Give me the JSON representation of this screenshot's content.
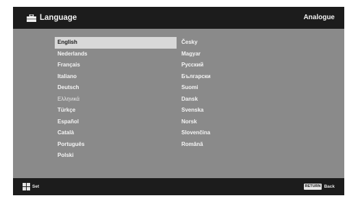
{
  "header": {
    "title": "Language",
    "mode": "Analogue",
    "icon": "toolbox-icon"
  },
  "languages": {
    "left": [
      {
        "label": "English",
        "selected": true
      },
      {
        "label": "Nederlands"
      },
      {
        "label": "Français"
      },
      {
        "label": "Italiano"
      },
      {
        "label": "Deutsch"
      },
      {
        "label": "Ελληνικά"
      },
      {
        "label": "Türkçe"
      },
      {
        "label": "Español"
      },
      {
        "label": "Català"
      },
      {
        "label": "Português"
      },
      {
        "label": "Polski"
      }
    ],
    "right": [
      {
        "label": "Česky"
      },
      {
        "label": "Magyar"
      },
      {
        "label": "Русский"
      },
      {
        "label": "Български"
      },
      {
        "label": "Suomi"
      },
      {
        "label": "Dansk"
      },
      {
        "label": "Svenska"
      },
      {
        "label": "Norsk"
      },
      {
        "label": "Slovenčina"
      },
      {
        "label": "Română"
      }
    ]
  },
  "footer": {
    "set_label": "Set",
    "set_icon": "cross-keys-icon",
    "return_key": "RETURN",
    "back_label": "Back"
  },
  "colors": {
    "background": "#8a8a8a",
    "bars": "#1c1c1c",
    "selection": "#d8d8d8"
  }
}
